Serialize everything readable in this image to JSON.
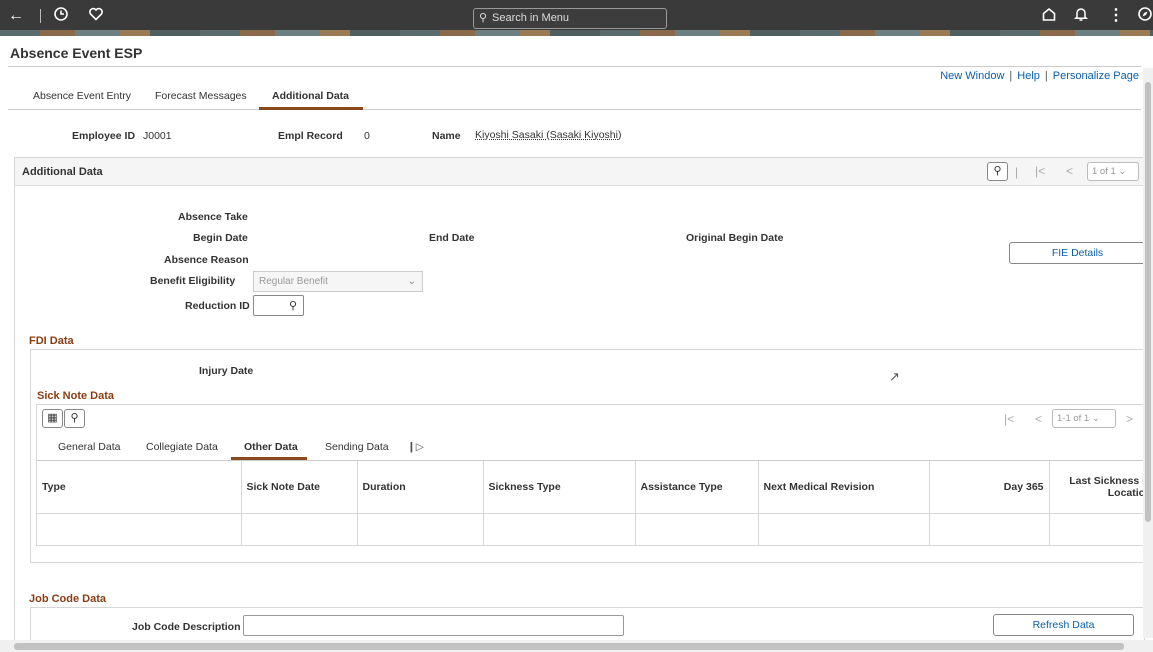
{
  "topbar": {
    "search_placeholder": "Search in Menu",
    "back_icon": "arrow-left-icon",
    "history_icon": "clock-icon",
    "favorites_icon": "heart-icon",
    "home_icon": "home-icon",
    "notifications_icon": "bell-icon",
    "actions_icon": "kebab-icon",
    "navbar_icon": "compass-icon"
  },
  "page": {
    "title": "Absence Event ESP"
  },
  "links": {
    "new_window": "New Window",
    "help": "Help",
    "personalize": "Personalize Page",
    "sep": "|"
  },
  "tabs": [
    {
      "label": "Absence Event Entry"
    },
    {
      "label": "Forecast Messages"
    },
    {
      "label": "Additional Data"
    }
  ],
  "employee": {
    "id_label": "Employee ID",
    "id_value": "J0001",
    "record_label": "Empl Record",
    "record_value": "0",
    "name_label": "Name",
    "name_value": "Kiyoshi Sasaki (Sasaki Kiyoshi)"
  },
  "additional": {
    "title": "Additional Data",
    "pager": "1 of 1",
    "absence_take": "Absence Take",
    "begin_date": "Begin Date",
    "end_date": "End Date",
    "original_begin_date": "Original Begin Date",
    "absence_reason": "Absence Reason",
    "benefit_eligibility": "Benefit Eligibility",
    "benefit_value": "Regular Benefit",
    "reduction_id": "Reduction ID",
    "fie_button": "FIE Details"
  },
  "fdi": {
    "title": "FDI Data",
    "injury_date": "Injury Date"
  },
  "sick_note": {
    "title": "Sick Note Data",
    "pager": "1-1 of 1",
    "subtabs": [
      "General Data",
      "Collegiate Data",
      "Other Data",
      "Sending Data"
    ],
    "columns": [
      "Type",
      "Sick Note Date",
      "Duration",
      "Sickness Type",
      "Assistance Type",
      "Next Medical Revision",
      "Day 365",
      "Last Sickness in Location"
    ]
  },
  "job_code": {
    "title": "Job Code Data",
    "description_label": "Job Code Description",
    "refresh_button": "Refresh Data"
  },
  "colors": {
    "accent": "#8a3d12",
    "link": "#0a5fa8",
    "topbar": "#3a3a3a"
  }
}
